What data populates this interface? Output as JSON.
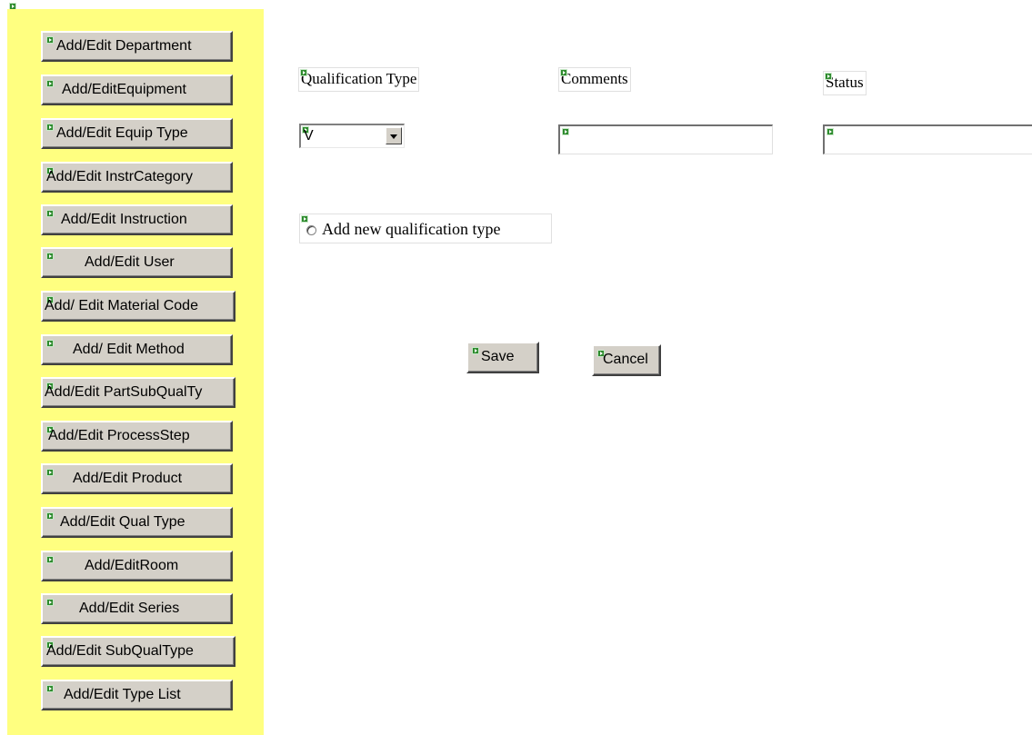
{
  "sidebar": {
    "items": [
      {
        "label": "Add/Edit Department"
      },
      {
        "label": "Add/EditEquipment"
      },
      {
        "label": "Add/Edit Equip Type"
      },
      {
        "label": "Add/Edit InstrCategory"
      },
      {
        "label": "Add/Edit Instruction"
      },
      {
        "label": "Add/Edit User"
      },
      {
        "label": "Add/ Edit Material Code"
      },
      {
        "label": "Add/ Edit Method"
      },
      {
        "label": "Add/Edit PartSubQualTy"
      },
      {
        "label": "Add/Edit ProcessStep"
      },
      {
        "label": "Add/Edit Product"
      },
      {
        "label": "Add/Edit Qual Type"
      },
      {
        "label": "Add/EditRoom"
      },
      {
        "label": "Add/Edit Series"
      },
      {
        "label": "Add/Edit SubQualType"
      },
      {
        "label": "Add/Edit Type List"
      }
    ]
  },
  "form": {
    "qualification_type_label": "Qualification Type",
    "comments_label": "Comments",
    "status_label": "Status",
    "qualification_type_value": "V",
    "comments_value": "",
    "status_value": "",
    "add_new_label": "Add new qualification type",
    "save_label": "Save",
    "cancel_label": "Cancel"
  },
  "colors": {
    "sidebar_bg": "#ffff80",
    "button_face": "#d4d0c8",
    "marker": "#2e8b2e"
  },
  "icons": [
    "marker-icon",
    "dropdown-arrow-icon",
    "radio-button"
  ]
}
